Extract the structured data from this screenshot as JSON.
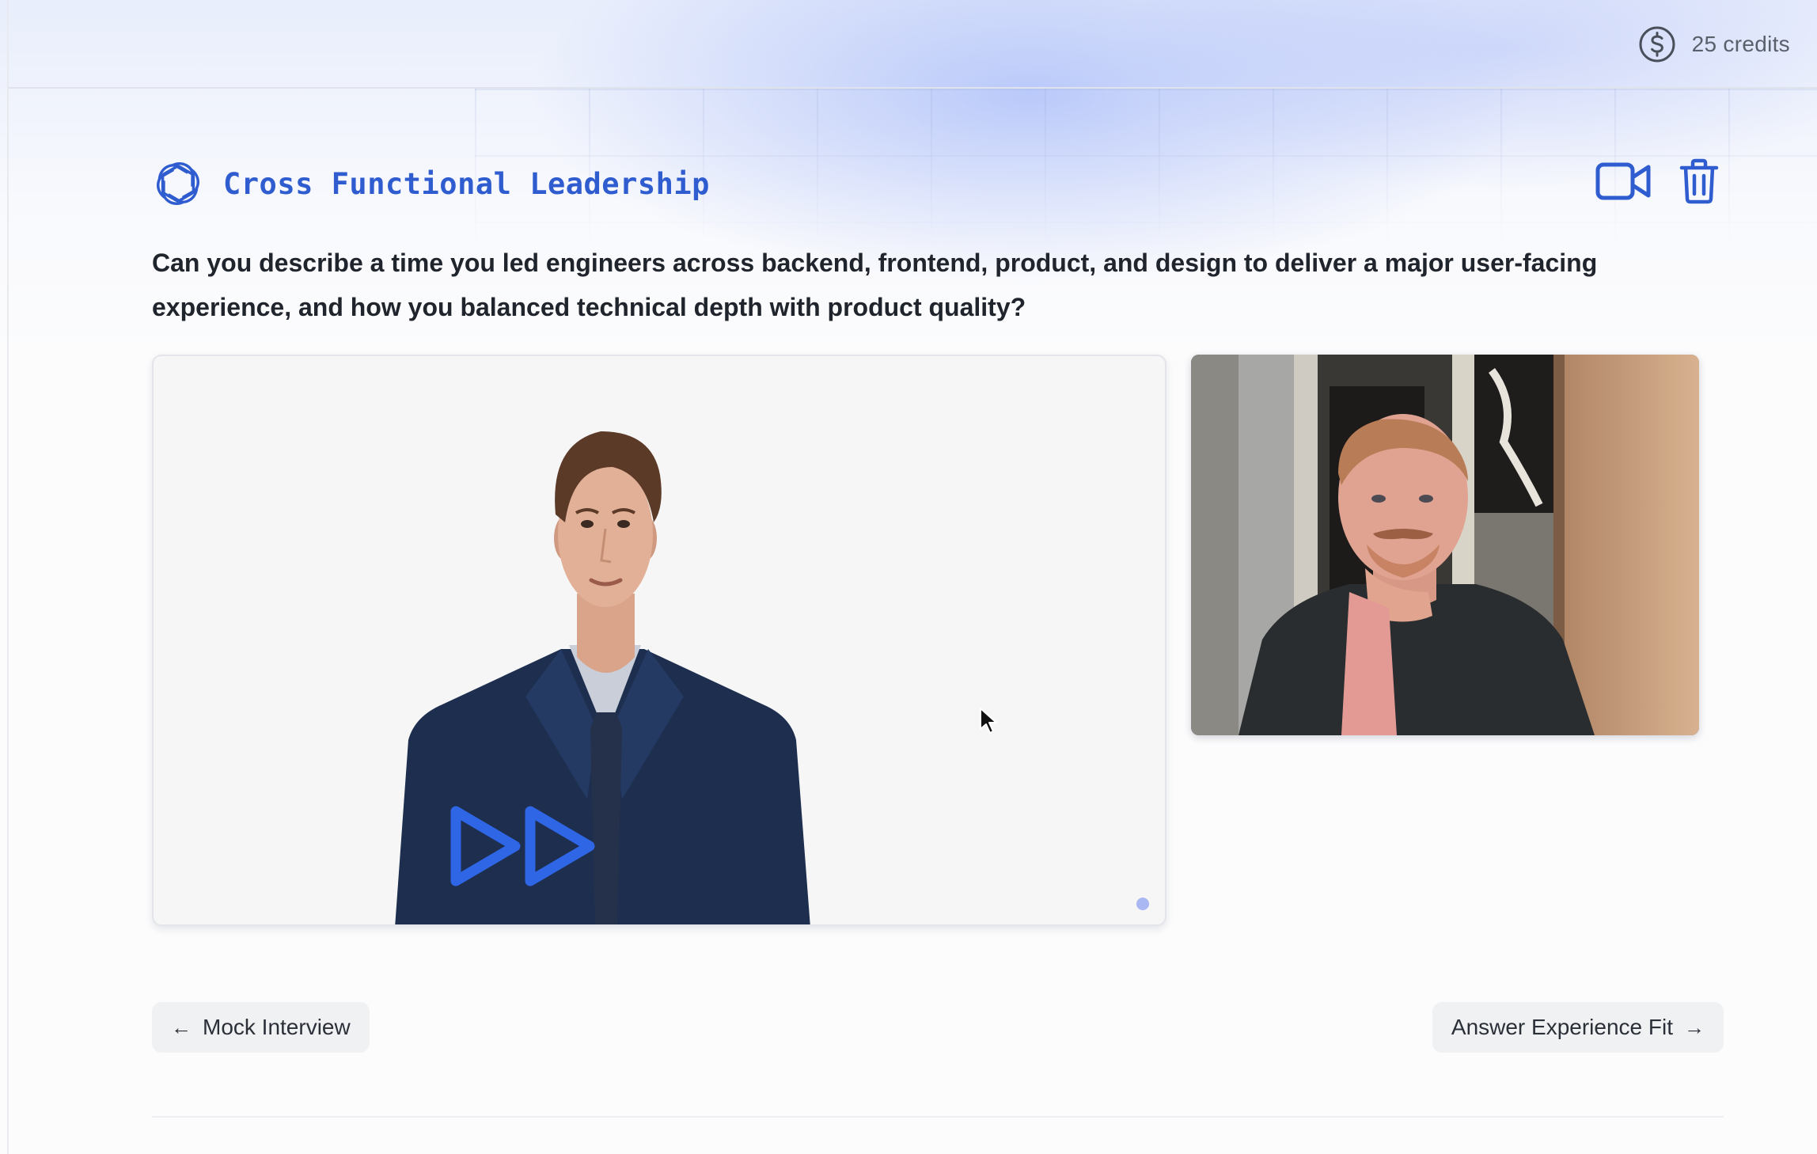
{
  "header": {
    "credits_icon": "dollar-circle-icon",
    "credits_label": "25 credits"
  },
  "question_card": {
    "logo_icon": "openai-logo-icon",
    "title": "Cross Functional Leadership",
    "question": "Can you describe a time you led engineers across backend, frontend, product, and design to deliver a major user-facing experience, and how you balanced technical depth with product quality?",
    "actions": [
      {
        "name": "video-camera-icon"
      },
      {
        "name": "trash-icon"
      }
    ]
  },
  "media": {
    "interviewer_video": {
      "overlay_icon": "fast-forward-icon"
    },
    "self_video": {}
  },
  "navigation": {
    "prev_label": "Mock Interview",
    "prev_arrow": "←",
    "next_label": "Answer Experience Fit",
    "next_arrow": "→"
  },
  "colors": {
    "accent": "#2f5ccf",
    "title_color": "#2f5ccf",
    "text": "#20242c",
    "muted": "#5a606b",
    "button_bg": "#f0f1f3"
  }
}
